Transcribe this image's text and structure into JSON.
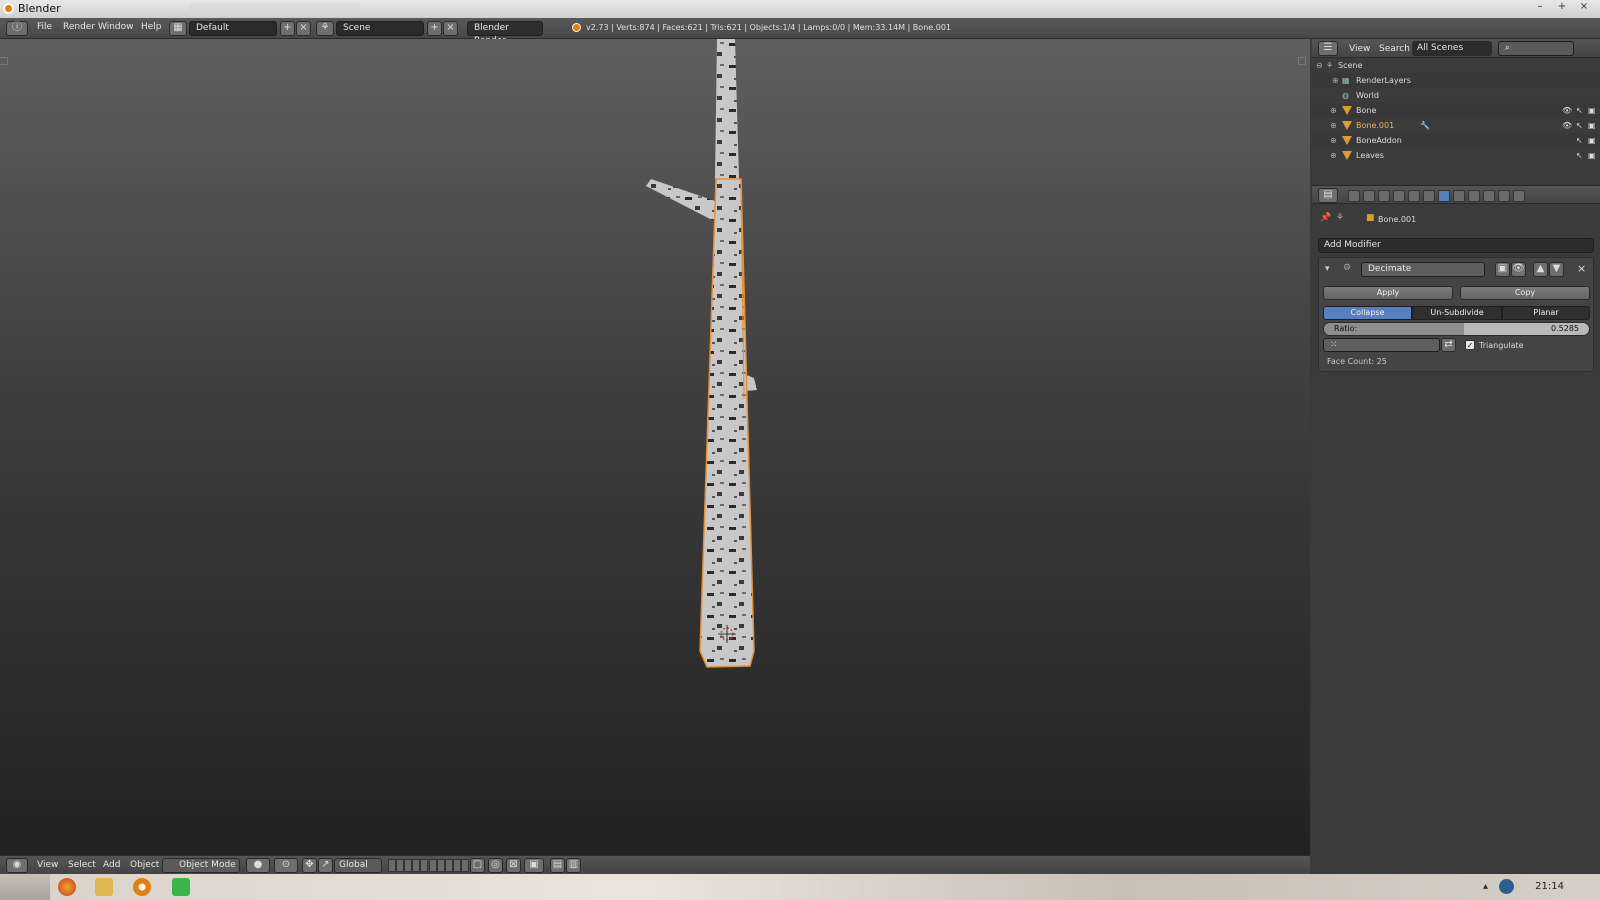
{
  "window": {
    "title": "Blender",
    "controls": [
      "–",
      "+",
      "×"
    ]
  },
  "menu": {
    "items": [
      "File",
      "Render",
      "Window",
      "Help"
    ]
  },
  "layout": {
    "screen": "Default",
    "scene": "Scene",
    "engine": "Blender Render"
  },
  "stats": "v2.73 | Verts:874 | Faces:621 | Tris:621 | Objects:1/4 | Lamps:0/0 | Mem:33.14M | Bone.001",
  "viewport_header": {
    "items": [
      "View",
      "Select",
      "Add",
      "Object"
    ],
    "mode": "Object Mode",
    "orientation": "Global"
  },
  "outliner": {
    "header": {
      "view": "View",
      "search": "Search",
      "scenes": "All Scenes"
    },
    "rows": [
      {
        "label": "Scene"
      },
      {
        "label": "RenderLayers"
      },
      {
        "label": "World"
      },
      {
        "label": "Bone"
      },
      {
        "label": "Bone.001"
      },
      {
        "label": "BoneAddon"
      },
      {
        "label": "Leaves"
      }
    ]
  },
  "properties": {
    "object": "Bone.001",
    "add_modifier": "Add Modifier",
    "modifier": {
      "name": "Decimate",
      "apply": "Apply",
      "copy": "Copy",
      "modes": [
        "Collapse",
        "Un-Subdivide",
        "Planar"
      ],
      "active_mode": "Collapse",
      "ratio_label": "Ratio:",
      "ratio_value": "0.5285",
      "ratio": 0.5285,
      "triangulate": "Triangulate",
      "triangulate_checked": true,
      "face_count": "Face Count: 25"
    }
  },
  "taskbar": {
    "clock": "21:14"
  },
  "colors": {
    "accent": "#5680c2",
    "selection": "#e09a2e",
    "blender_orange": "#e87d0d"
  }
}
